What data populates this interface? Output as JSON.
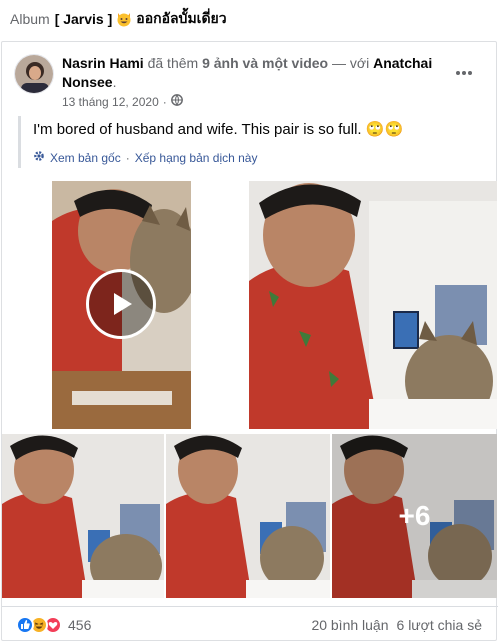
{
  "album": {
    "prefix": "Album",
    "name": "[ Jarvis ]",
    "title": "ออกอัลบั้มเดี่ยว",
    "emoji_icon": "grinning-cat-emoji-icon"
  },
  "post": {
    "author": "Nasrin Hami",
    "action": "đã thêm",
    "media_summary": "9 ảnh và một video",
    "connector": "— với",
    "tagged": "Anatchai Nonsee",
    "tagged_suffix": ".",
    "date": "13 tháng 12, 2020",
    "date_sep": "·",
    "privacy_icon": "globe-icon",
    "text": "I'm bored of husband and wife. This pair is so full. 🙄🙄",
    "see_original": "Xem bản gốc",
    "rate_translation": "Xếp hạng bản dịch này",
    "separator": "·",
    "more_overlay": "+6"
  },
  "footer": {
    "reaction_count": "456",
    "comments": "20 bình luận",
    "shares": "6 lượt chia sẻ"
  },
  "colors": {
    "link_blue": "#385898",
    "like_blue": "#1877f2",
    "haha_yellow": "#f7b125",
    "love_red": "#f33e58",
    "secondary_text": "#65676b"
  }
}
